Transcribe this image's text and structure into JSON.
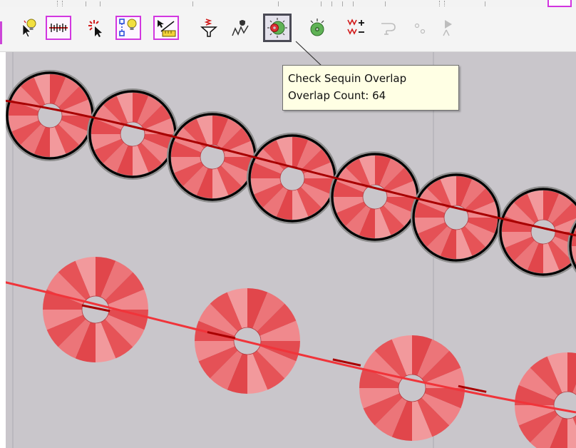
{
  "toolbar": {
    "buttons": [
      {
        "name": "select-pointer-tool",
        "icon": "pointer-bulb-icon"
      },
      {
        "name": "ruler-tool",
        "icon": "ruler-icon"
      },
      {
        "name": "sparkle-select-tool",
        "icon": "sparkle-cursor-icon"
      },
      {
        "name": "node-bulb-tool",
        "icon": "node-bulb-icon"
      },
      {
        "name": "measure-tool",
        "icon": "measure-icon"
      },
      {
        "name": "filter-tool",
        "icon": "filter-funnel-icon"
      },
      {
        "name": "path-tool",
        "icon": "path-zigzag-icon"
      },
      {
        "name": "check-sequin-overlap-button",
        "icon": "sequin-overlap-icon"
      },
      {
        "name": "sequin-tool",
        "icon": "sequin-icon"
      },
      {
        "name": "stitch-plus-minus-tool",
        "icon": "stitch-plus-minus-icon"
      },
      {
        "name": "connect-tool",
        "icon": "connect-icon"
      },
      {
        "name": "dots-tool",
        "icon": "dots-icon"
      },
      {
        "name": "flag-cursor-tool",
        "icon": "flag-cursor-icon"
      }
    ]
  },
  "tooltip": {
    "title": "Check Sequin Overlap",
    "overlap_label": "Overlap Count: 64"
  },
  "colors": {
    "canvas_bg": "#c9c6cb",
    "sequin_red": "#e8585c",
    "sequin_dark_line": "#a80000",
    "overlap_outline": "#000000",
    "highlight_magenta": "#d237e0",
    "tooltip_bg": "#ffffe4"
  }
}
